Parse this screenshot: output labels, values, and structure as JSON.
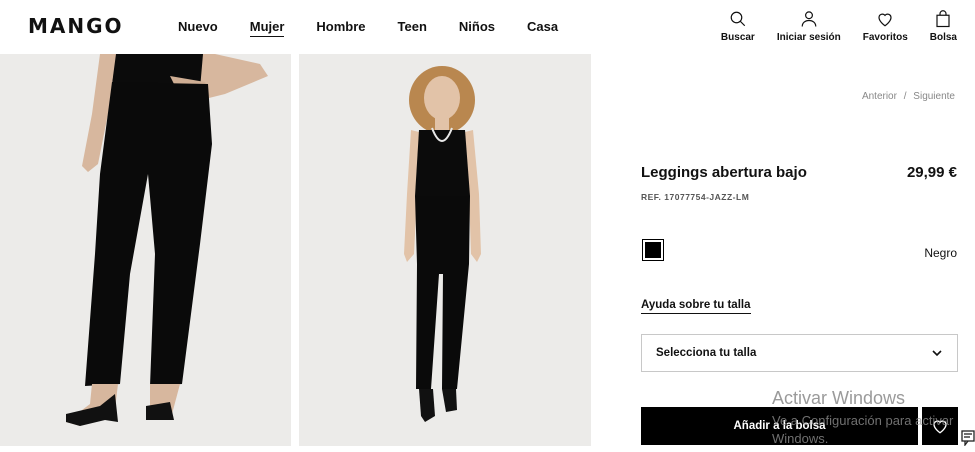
{
  "header": {
    "logo": "MANGO",
    "nav": [
      "Nuevo",
      "Mujer",
      "Hombre",
      "Teen",
      "Niños",
      "Casa"
    ],
    "active_nav": "Mujer",
    "actions": {
      "search": "Buscar",
      "login": "Iniciar sesión",
      "favorites": "Favoritos",
      "bag": "Bolsa"
    }
  },
  "pager": {
    "prev": "Anterior",
    "sep": "/",
    "next": "Siguiente"
  },
  "product": {
    "title": "Leggings abertura bajo",
    "price": "29,99 €",
    "ref": "REF. 17077754-JAZZ-LM",
    "color_name": "Negro",
    "swatch_color": "#000000"
  },
  "size": {
    "help_link": "Ayuda sobre tu talla",
    "select_label": "Selecciona tu talla"
  },
  "cart": {
    "add_label": "Añadir a la bolsa"
  },
  "watermark": {
    "line1": "Activar Windows",
    "line2": "Ve a Configuración para activar",
    "line3": "Windows."
  }
}
